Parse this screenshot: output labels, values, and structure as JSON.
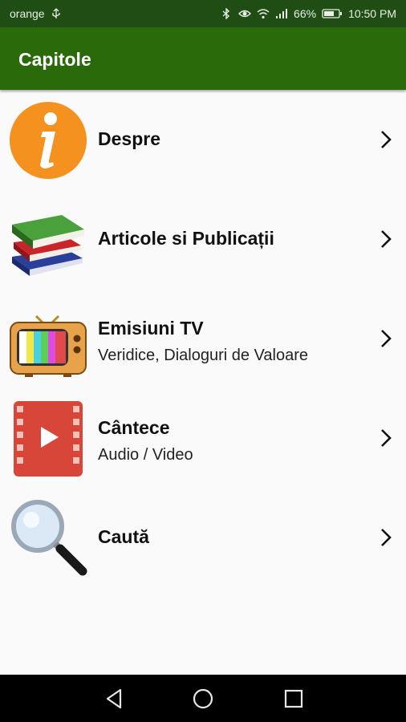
{
  "status_bar": {
    "carrier": "orange",
    "battery": "66%",
    "time": "10:50 PM",
    "icons": [
      "usb-icon",
      "bluetooth-icon",
      "eye-icon",
      "wifi-icon",
      "signal-icon",
      "battery-icon"
    ]
  },
  "app_bar": {
    "title": "Capitole"
  },
  "menu": {
    "items": [
      {
        "title": "Despre",
        "subtitle": "",
        "icon": "info-icon"
      },
      {
        "title": "Articole si Publicații",
        "subtitle": "",
        "icon": "books-icon"
      },
      {
        "title": "Emisiuni TV",
        "subtitle": "Veridice, Dialoguri de Valoare",
        "icon": "tv-icon"
      },
      {
        "title": "Cântece",
        "subtitle": "Audio / Video",
        "icon": "video-play-icon"
      },
      {
        "title": "Caută",
        "subtitle": "",
        "icon": "magnifier-icon"
      }
    ]
  },
  "colors": {
    "app_bar": "#2b6a0a",
    "status_bar": "#1f4d14",
    "background": "#fafafa"
  },
  "nav_bar": {
    "icons": [
      "back-icon",
      "home-icon",
      "recents-icon"
    ]
  }
}
